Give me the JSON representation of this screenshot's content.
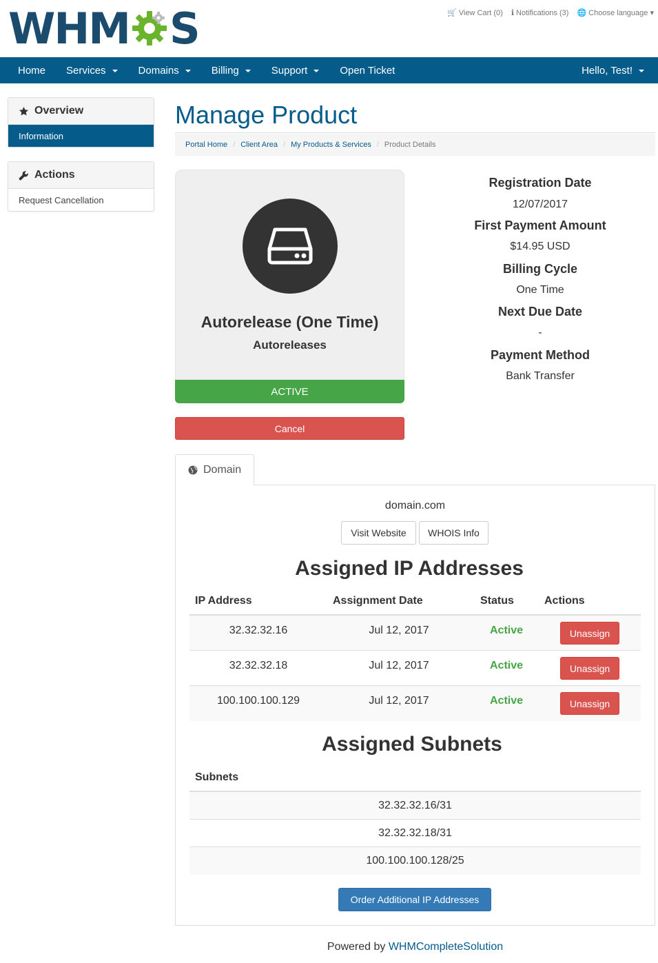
{
  "header": {
    "logo_left": "WHM",
    "logo_right": "S",
    "top_links": [
      {
        "icon": "cart-icon",
        "label": "View Cart (0)"
      },
      {
        "icon": "info-icon",
        "label": "Notifications (3)"
      },
      {
        "icon": "language-icon",
        "label": "Choose language"
      }
    ]
  },
  "nav": {
    "items": [
      {
        "label": "Home"
      },
      {
        "label": "Services"
      },
      {
        "label": "Domains"
      },
      {
        "label": "Billing"
      },
      {
        "label": "Support"
      },
      {
        "label": "Open Ticket"
      }
    ],
    "user": "Hello, Test!"
  },
  "sidebar": {
    "overview": {
      "title": "Overview",
      "items": [
        "Information"
      ]
    },
    "actions": {
      "title": "Actions",
      "items": [
        "Request Cancellation"
      ]
    }
  },
  "page": {
    "title": "Manage Product",
    "breadcrumb": [
      "Portal Home",
      "Client Area",
      "My Products & Services",
      "Product Details"
    ]
  },
  "product": {
    "name": "Autorelease (One Time)",
    "group": "Autoreleases",
    "status": "ACTIVE",
    "cancel_label": "Cancel",
    "info": [
      {
        "label": "Registration Date",
        "value": "12/07/2017"
      },
      {
        "label": "First Payment Amount",
        "value": "$14.95 USD"
      },
      {
        "label": "Billing Cycle",
        "value": "One Time"
      },
      {
        "label": "Next Due Date",
        "value": "-"
      },
      {
        "label": "Payment Method",
        "value": "Bank Transfer"
      }
    ]
  },
  "tab": {
    "label": "Domain",
    "domain": "domain.com",
    "visit_label": "Visit Website",
    "whois_label": "WHOIS Info"
  },
  "ip_section": {
    "title": "Assigned IP Addresses",
    "headers": [
      "IP Address",
      "Assignment Date",
      "Status",
      "Actions"
    ],
    "rows": [
      {
        "ip": "32.32.32.16",
        "date": "Jul 12, 2017",
        "status": "Active",
        "action": "Unassign"
      },
      {
        "ip": "32.32.32.18",
        "date": "Jul 12, 2017",
        "status": "Active",
        "action": "Unassign"
      },
      {
        "ip": "100.100.100.129",
        "date": "Jul 12, 2017",
        "status": "Active",
        "action": "Unassign"
      }
    ]
  },
  "subnet_section": {
    "title": "Assigned Subnets",
    "header": "Subnets",
    "rows": [
      "32.32.32.16/31",
      "32.32.32.18/31",
      "100.100.100.128/25"
    ]
  },
  "order_label": "Order Additional IP Addresses",
  "footer": {
    "prefix": "Powered by ",
    "link": "WHMCompleteSolution"
  },
  "colors": {
    "brand": "#055b8a",
    "logo_blue": "#1b4c6d",
    "gear_green": "#6ab42d",
    "success": "#46a546",
    "danger": "#d9534f",
    "primary": "#337ab7"
  }
}
